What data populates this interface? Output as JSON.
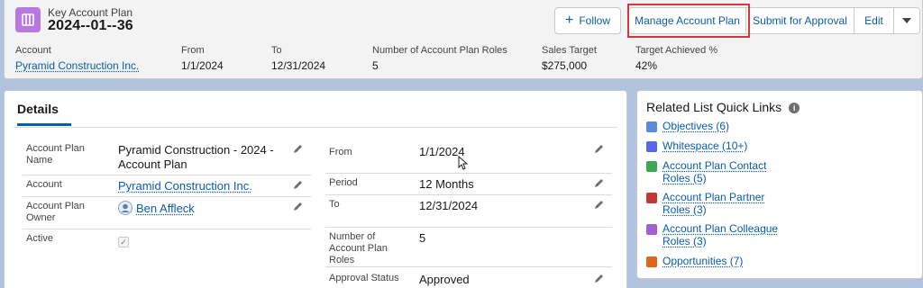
{
  "header": {
    "object_label": "Key Account Plan",
    "record_name": "2024--01--36",
    "actions": {
      "follow": "Follow",
      "manage": "Manage Account Plan",
      "submit": "Submit for Approval",
      "edit": "Edit"
    },
    "fields": [
      {
        "label": "Account",
        "value": "Pyramid Construction Inc."
      },
      {
        "label": "From",
        "value": "1/1/2024"
      },
      {
        "label": "To",
        "value": "12/31/2024"
      },
      {
        "label": "Number of Account Plan Roles",
        "value": "5"
      },
      {
        "label": "Sales Target",
        "value": "$275,000"
      },
      {
        "label": "Target Achieved %",
        "value": "42%"
      }
    ]
  },
  "details": {
    "tab": "Details",
    "left": [
      {
        "label": "Account Plan Name",
        "value": "Pyramid Construction - 2024 - Account Plan"
      },
      {
        "label": "Account",
        "value": "Pyramid Construction Inc."
      },
      {
        "label": "Account Plan Owner",
        "value": "Ben Affleck"
      },
      {
        "label": "Active",
        "checked": true
      }
    ],
    "right": [
      {
        "label": "From",
        "value": "1/1/2024"
      },
      {
        "label": "Period",
        "value": "12 Months"
      },
      {
        "label": "To",
        "value": "12/31/2024"
      },
      {
        "label": "Number of Account Plan Roles",
        "value": "5"
      },
      {
        "label": "Approval Status",
        "value": "Approved"
      }
    ]
  },
  "related": {
    "title": "Related List Quick Links",
    "items": [
      {
        "label": "Objectives (6)",
        "color": "#5a8bd8"
      },
      {
        "label": "Whitespace (10+)",
        "color": "#5867e8"
      },
      {
        "label": "Account Plan Contact Roles (5)",
        "color": "#3ba755"
      },
      {
        "label": "Account Plan Partner Roles (3)",
        "color": "#c23934"
      },
      {
        "label": "Account Plan Colleague Roles (3)",
        "color": "#a35fd6"
      },
      {
        "label": "Opportunities (7)",
        "color": "#e0661c"
      }
    ]
  },
  "colors": {
    "brand": "#0b5cab",
    "record_icon": "#b779e0",
    "highlight": "#d9363e"
  }
}
